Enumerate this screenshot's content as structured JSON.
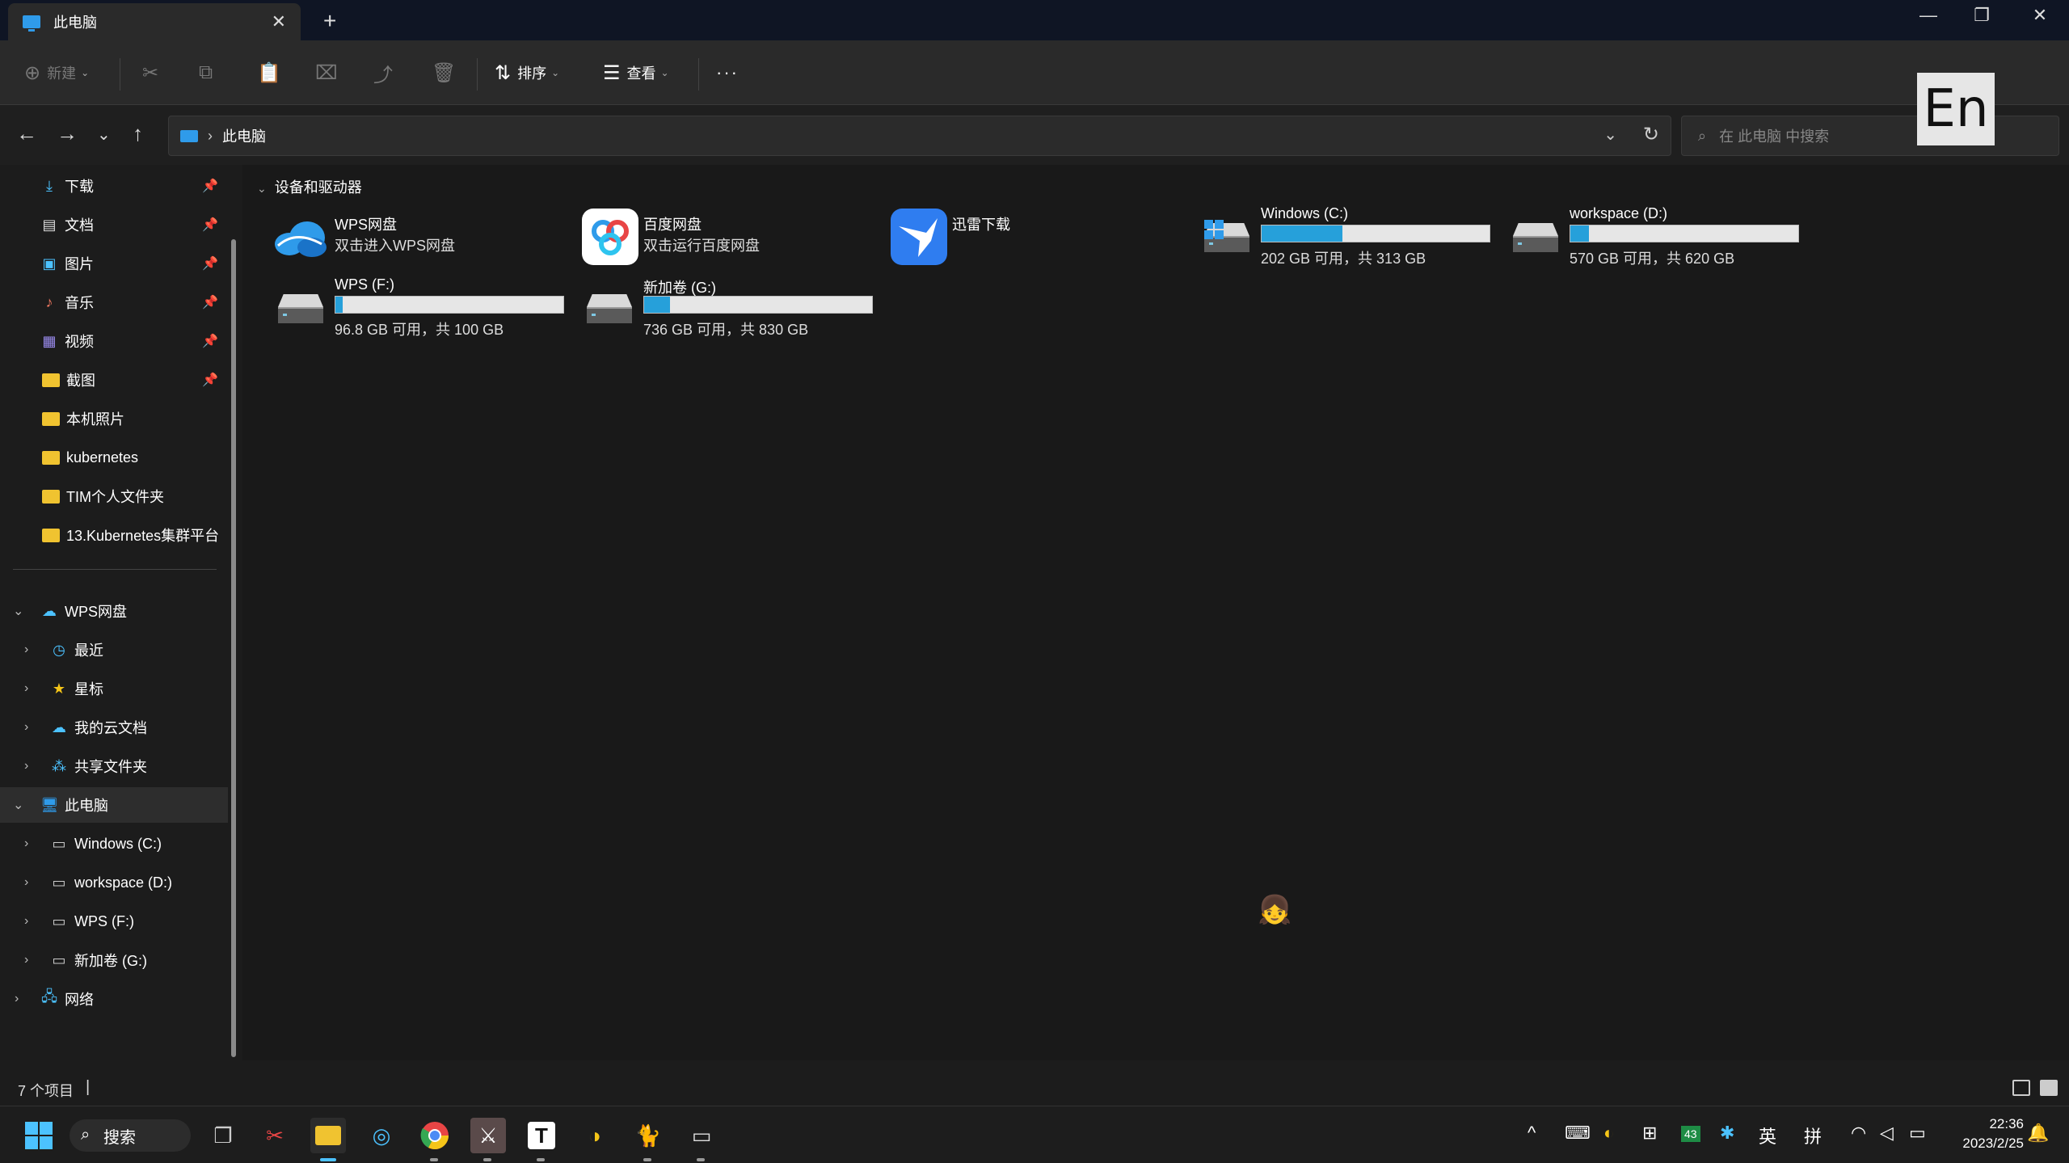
{
  "window": {
    "tab_title": "此电脑",
    "new_tab": "+",
    "close_tab": "✕",
    "min": "—",
    "restore": "❐",
    "close": "✕"
  },
  "toolbar": {
    "new": "新建",
    "sort": "排序",
    "view": "查看",
    "more": "···"
  },
  "address": {
    "location": "此电脑",
    "search_placeholder": "在 此电脑 中搜索"
  },
  "ime_badge": "En",
  "sidebar": {
    "quick": [
      {
        "label": "下载",
        "icon": "download-icon",
        "pinned": true
      },
      {
        "label": "文档",
        "icon": "document-icon",
        "pinned": true
      },
      {
        "label": "图片",
        "icon": "pictures-icon",
        "pinned": true
      },
      {
        "label": "音乐",
        "icon": "music-icon",
        "pinned": true
      },
      {
        "label": "视频",
        "icon": "video-icon",
        "pinned": true
      },
      {
        "label": "截图",
        "icon": "folder-icon",
        "pinned": true
      },
      {
        "label": "本机照片",
        "icon": "folder-icon",
        "pinned": false
      },
      {
        "label": "kubernetes",
        "icon": "folder-icon",
        "pinned": false
      },
      {
        "label": "TIM个人文件夹",
        "icon": "folder-icon",
        "pinned": false
      },
      {
        "label": "13.Kubernetes集群平台",
        "icon": "folder-icon",
        "pinned": false
      }
    ],
    "wps": "WPS网盘",
    "wps_items": [
      "最近",
      "星标",
      "我的云文档",
      "共享文件夹"
    ],
    "pc": "此电脑",
    "pc_items": [
      "Windows (C:)",
      "workspace (D:)",
      "WPS (F:)",
      "新加卷 (G:)"
    ],
    "network": "网络"
  },
  "content": {
    "group_title": "设备和驱动器",
    "apps": [
      {
        "name": "WPS网盘",
        "sub": "双击进入WPS网盘"
      },
      {
        "name": "百度网盘",
        "sub": "双击运行百度网盘"
      },
      {
        "name": "迅雷下载",
        "sub": ""
      }
    ],
    "drives": [
      {
        "name": "Windows (C:)",
        "free": "202 GB 可用，共 313 GB",
        "used_fraction": 0.355
      },
      {
        "name": "workspace (D:)",
        "free": "570 GB 可用，共 620 GB",
        "used_fraction": 0.081
      },
      {
        "name": "WPS (F:)",
        "free": "96.8 GB 可用，共 100 GB",
        "used_fraction": 0.032
      },
      {
        "name": "新加卷 (G:)",
        "free": "736 GB 可用，共 830 GB",
        "used_fraction": 0.113
      }
    ]
  },
  "status": {
    "count": "7 个项目"
  },
  "taskbar": {
    "search": "搜索",
    "tray_lang1": "英",
    "tray_lang2": "拼",
    "tray_badge": "43",
    "time": "22:36",
    "date": "2023/2/25"
  },
  "colors": {
    "accent": "#2f9bea",
    "drive_fill": "#26a0da",
    "folder": "#f0c330"
  }
}
